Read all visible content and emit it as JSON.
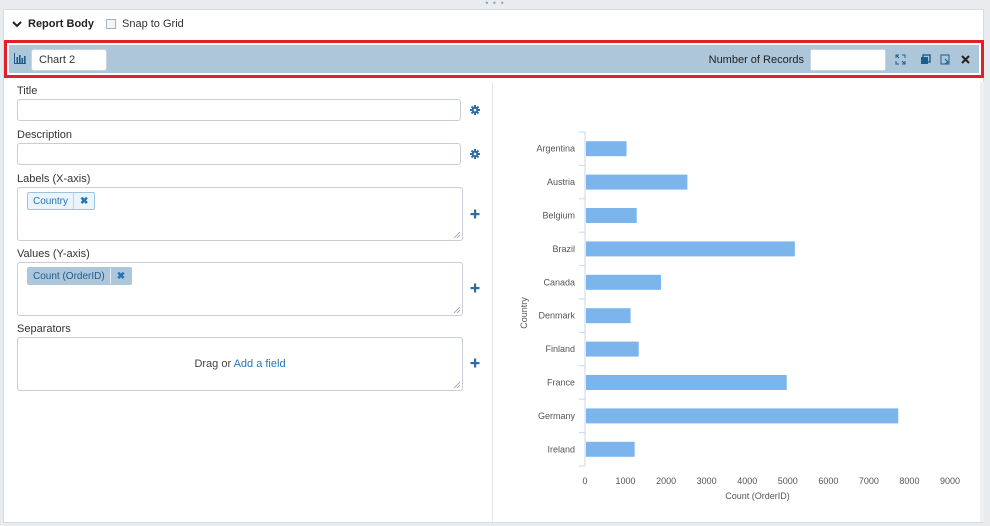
{
  "top_handle": "• • •",
  "report": {
    "title": "Report Body",
    "snap_label": "Snap to Grid"
  },
  "toolbar": {
    "chart_name": "Chart 2",
    "records_label": "Number of Records",
    "records_value": ""
  },
  "fields": {
    "title_label": "Title",
    "description_label": "Description",
    "labels_label": "Labels (X-axis)",
    "labels_pill": "Country",
    "values_label": "Values (Y-axis)",
    "values_pill": "Count (OrderID)",
    "separators_label": "Separators",
    "drag_text": "Drag or",
    "add_field_link": "Add a field",
    "pill_remove": "✖"
  },
  "chart_data": {
    "type": "bar",
    "orientation": "horizontal",
    "categories": [
      "Argentina",
      "Austria",
      "Belgium",
      "Brazil",
      "Canada",
      "Denmark",
      "Finland",
      "France",
      "Germany",
      "Ireland"
    ],
    "values": [
      1000,
      2500,
      1250,
      5150,
      1850,
      1100,
      1300,
      4950,
      7700,
      1200
    ],
    "ylabel": "Country",
    "xlabel": "Count (OrderID)",
    "xlim": [
      0,
      9000
    ],
    "xticks": [
      0,
      1000,
      2000,
      3000,
      4000,
      5000,
      6000,
      7000,
      8000,
      9000
    ],
    "bar_color": "#7cb5ec",
    "grid": false
  },
  "colors": {
    "accent": "#2476b3",
    "toolbar_bg": "#adc6d9",
    "highlight_border": "#e0202a"
  }
}
